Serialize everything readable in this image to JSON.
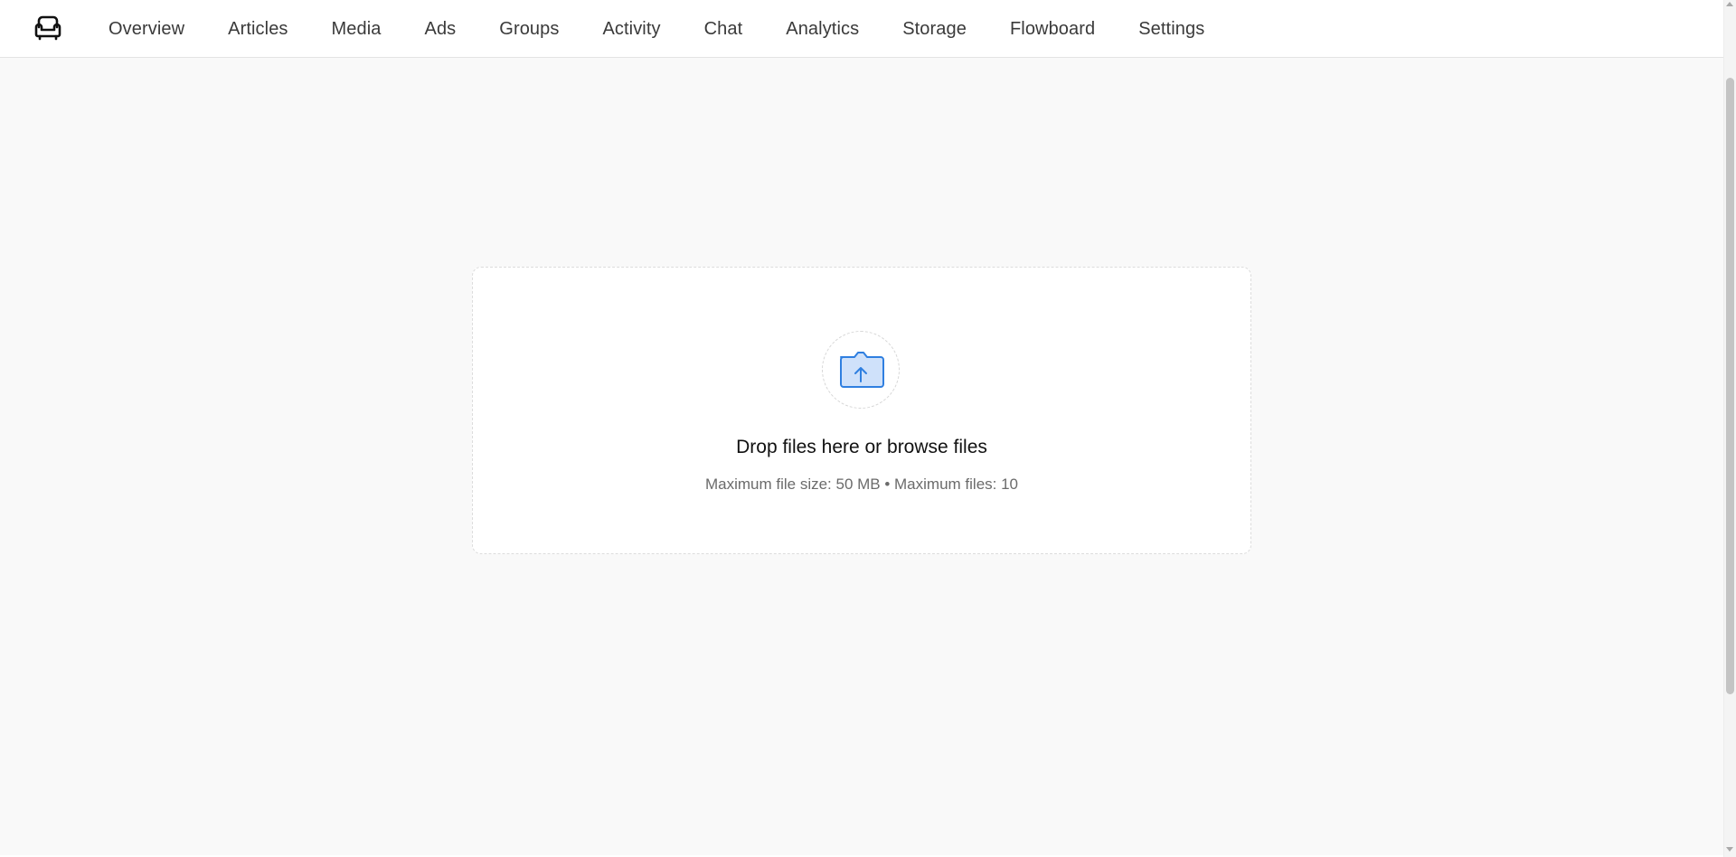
{
  "nav": {
    "logo_icon": "sofa-icon",
    "items": [
      {
        "label": "Overview"
      },
      {
        "label": "Articles"
      },
      {
        "label": "Media"
      },
      {
        "label": "Ads"
      },
      {
        "label": "Groups"
      },
      {
        "label": "Activity"
      },
      {
        "label": "Chat"
      },
      {
        "label": "Analytics"
      },
      {
        "label": "Storage"
      },
      {
        "label": "Flowboard"
      },
      {
        "label": "Settings"
      }
    ]
  },
  "upload": {
    "icon": "folder-upload-icon",
    "title": "Drop files here or browse files",
    "subtitle": "Maximum file size: 50 MB • Maximum files: 10",
    "accent_color": "#2f7fe0"
  }
}
